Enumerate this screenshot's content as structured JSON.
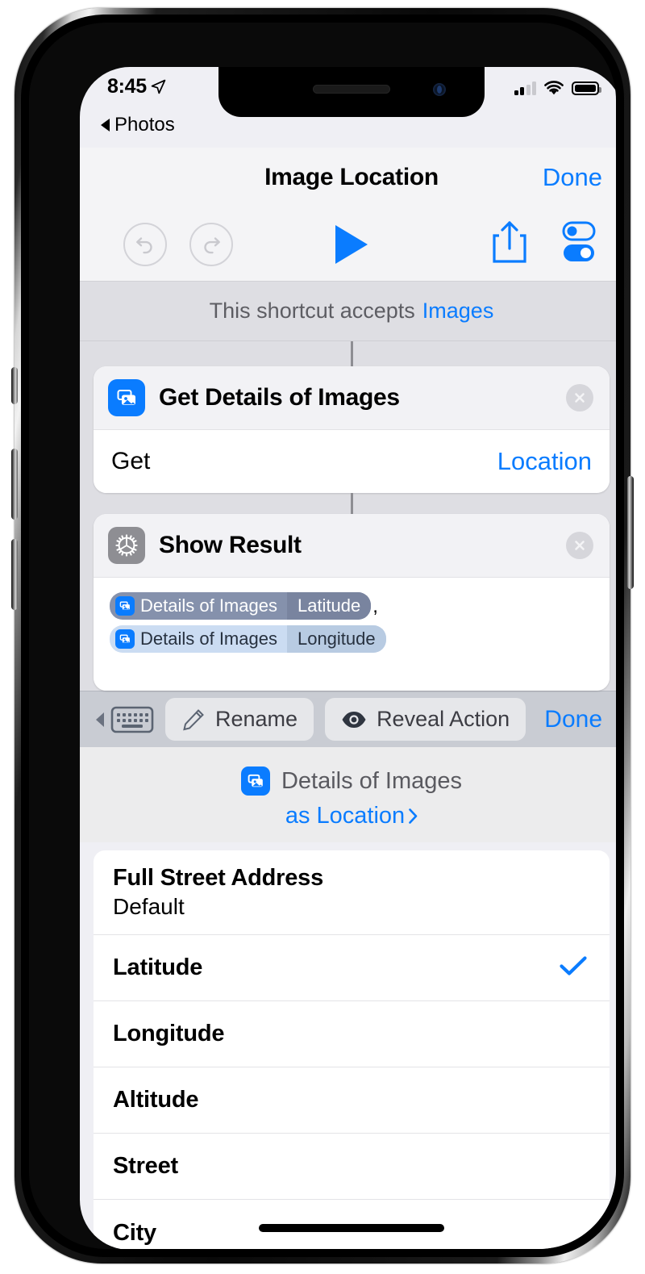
{
  "status_bar": {
    "time": "8:45",
    "location_icon": "location-arrow-icon",
    "signal_icon": "cellular-signal-icon",
    "wifi_icon": "wifi-icon",
    "battery_icon": "battery-icon"
  },
  "back_link": {
    "label": "Photos",
    "icon": "chevron-left-icon"
  },
  "nav": {
    "title": "Image Location",
    "done_label": "Done"
  },
  "toolbar": {
    "undo_icon": "undo-icon",
    "redo_icon": "redo-icon",
    "play_icon": "play-icon",
    "share_icon": "share-icon",
    "settings_icon": "toggles-settings-icon"
  },
  "accepts_banner": {
    "text": "This shortcut accepts",
    "type": "Images"
  },
  "actions": [
    {
      "icon": "photos-icon",
      "title": "Get Details of Images",
      "delete_icon": "close-circle-icon",
      "param_label": "Get",
      "param_value": "Location"
    },
    {
      "icon": "gear-icon",
      "title": "Show Result",
      "delete_icon": "close-circle-icon",
      "tokens": [
        {
          "icon": "photos-icon",
          "name": "Details of Images",
          "key": "Latitude",
          "selected": true
        },
        {
          "icon": "photos-icon",
          "name": "Details of Images",
          "key": "Longitude",
          "selected": false
        }
      ],
      "separator": ","
    }
  ],
  "accessory_bar": {
    "keyboard_icon": "keyboard-icon",
    "chevron_icon": "chevron-left-icon",
    "rename_label": "Rename",
    "rename_icon": "pencil-icon",
    "reveal_label": "Reveal Action",
    "reveal_icon": "eye-icon",
    "done_label": "Done"
  },
  "variable_detail": {
    "icon": "photos-icon",
    "name": "Details of Images",
    "as_label": "as Location",
    "chevron_icon": "chevron-right-icon"
  },
  "options": [
    {
      "main": "Full Street Address",
      "sub": "Default",
      "checked": false
    },
    {
      "main": "Latitude",
      "sub": "",
      "checked": true
    },
    {
      "main": "Longitude",
      "sub": "",
      "checked": false
    },
    {
      "main": "Altitude",
      "sub": "",
      "checked": false
    },
    {
      "main": "Street",
      "sub": "",
      "checked": false
    },
    {
      "main": "City",
      "sub": "",
      "checked": false
    }
  ],
  "colors": {
    "accent_blue": "#0a7cff",
    "icon_gray": "#8e8e93",
    "banner_bg": "#dedee3",
    "token_selected": "#8591ac",
    "token_unselected": "#cbdcf2"
  }
}
